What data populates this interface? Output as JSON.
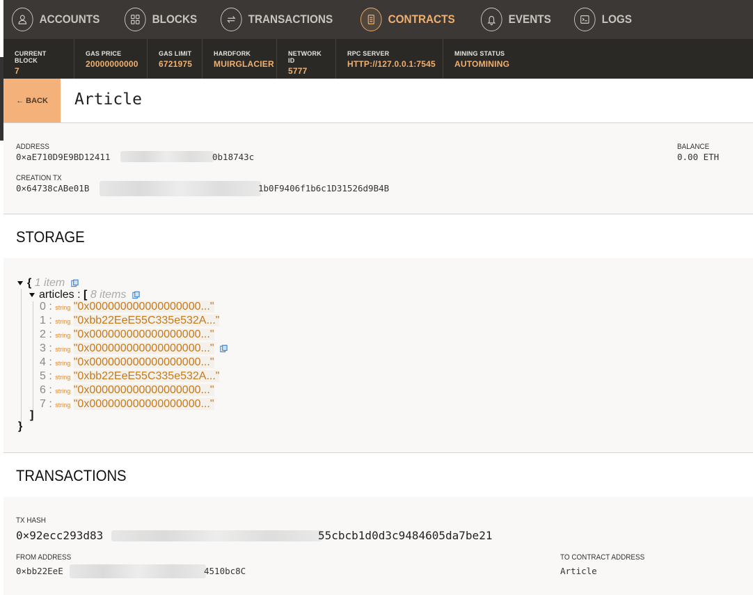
{
  "nav": {
    "items": [
      {
        "label": "ACCOUNTS",
        "icon": "user-icon"
      },
      {
        "label": "BLOCKS",
        "icon": "grid-icon"
      },
      {
        "label": "TRANSACTIONS",
        "icon": "swap-icon"
      },
      {
        "label": "CONTRACTS",
        "icon": "document-icon",
        "active": true
      },
      {
        "label": "EVENTS",
        "icon": "bell-icon"
      },
      {
        "label": "LOGS",
        "icon": "terminal-icon"
      }
    ]
  },
  "status": [
    {
      "label": "CURRENT BLOCK",
      "value": "7"
    },
    {
      "label": "GAS PRICE",
      "value": "20000000000"
    },
    {
      "label": "GAS LIMIT",
      "value": "6721975"
    },
    {
      "label": "HARDFORK",
      "value": "MUIRGLACIER"
    },
    {
      "label": "NETWORK ID",
      "value": "5777"
    },
    {
      "label": "RPC SERVER",
      "value": "HTTP://127.0.0.1:7545"
    },
    {
      "label": "MINING STATUS",
      "value": "AUTOMINING"
    }
  ],
  "page": {
    "back_label": "← BACK",
    "title": "Article"
  },
  "contract": {
    "address_label": "ADDRESS",
    "address_start": "0×aE710D9E9BD12411",
    "address_end": "0b18743c",
    "balance_label": "BALANCE",
    "balance_value": "0.00 ETH",
    "creation_label": "CREATION TX",
    "creation_start": "0×64738cABe01B",
    "creation_end": "1b0F9406f1b6c1D31526d9B4B"
  },
  "storage": {
    "heading": "STORAGE",
    "root_open": "{",
    "root_meta": "1 item",
    "key": "articles",
    "sep": ":",
    "arr_open": "[",
    "arr_meta": "8 items",
    "arr_close": "]",
    "root_close": "}",
    "type_label": "string",
    "entries": [
      {
        "index": "0",
        "value": "\"0x000000000000000000...\""
      },
      {
        "index": "1",
        "value": "\"0xbb22EeE55C335e532A...\""
      },
      {
        "index": "2",
        "value": "\"0x000000000000000000...\""
      },
      {
        "index": "3",
        "value": "\"0x000000000000000000...\""
      },
      {
        "index": "4",
        "value": "\"0x000000000000000000...\""
      },
      {
        "index": "5",
        "value": "\"0xbb22EeE55C335e532A...\""
      },
      {
        "index": "6",
        "value": "\"0x000000000000000000...\""
      },
      {
        "index": "7",
        "value": "\"0x000000000000000000...\""
      }
    ]
  },
  "transactions": {
    "heading": "TRANSACTIONS",
    "hash_label": "TX HASH",
    "hash_start": "0×92ecc293d83",
    "hash_end": "55cbcb1d0d3c9484605da7be21",
    "from_label": "FROM ADDRESS",
    "from_start": "0×bb22EeE",
    "from_end": "4510bc8C",
    "to_label": "TO CONTRACT ADDRESS",
    "to_value": "Article"
  },
  "colors": {
    "accent": "#f0b070",
    "nav_bg": "#3b3835",
    "status_bg": "#2b2926",
    "back_bg": "#f4b17a"
  }
}
